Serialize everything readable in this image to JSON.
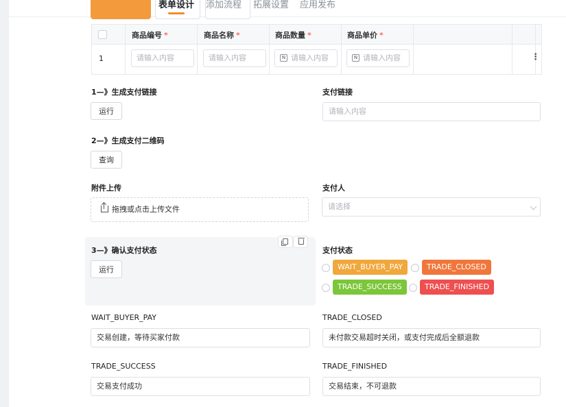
{
  "nav": {
    "tabs": [
      {
        "label": "表单设计",
        "active": true
      },
      {
        "label": "添加流程",
        "active": false
      },
      {
        "label": "拓展设置",
        "active": false
      },
      {
        "label": "应用发布",
        "active": false
      }
    ]
  },
  "table": {
    "columns": [
      {
        "label": "商品编号",
        "required": "*"
      },
      {
        "label": "商品名称",
        "required": "*"
      },
      {
        "label": "商品数量",
        "required": "*"
      },
      {
        "label": "商品单价",
        "required": "*"
      }
    ],
    "row": {
      "index": "1",
      "cells": [
        {
          "placeholder": "请输入内容",
          "icon": ""
        },
        {
          "placeholder": "请输入内容",
          "icon": ""
        },
        {
          "placeholder": "请输入内容",
          "icon": "N"
        },
        {
          "placeholder": "请输入内容",
          "icon": "N"
        }
      ],
      "menu_icon": "⋮"
    }
  },
  "form": {
    "step1": {
      "label": "1—》生成支付链接",
      "button": "运行"
    },
    "pay_link": {
      "label": "支付链接",
      "placeholder": "请输入内容"
    },
    "step2": {
      "label": "2—》生成支付二维码",
      "button": "查询"
    },
    "attachment": {
      "label": "附件上传",
      "upload_text": "拖拽或点击上传文件"
    },
    "payer": {
      "label": "支付人",
      "placeholder": "请选择"
    },
    "step3": {
      "label": "3—》确认支付状态",
      "button": "运行"
    },
    "pay_status": {
      "label": "支付状态",
      "options": [
        {
          "label": "WAIT_BUYER_PAY",
          "color": "#f0a73b"
        },
        {
          "label": "TRADE_CLOSED",
          "color": "#f0773c"
        },
        {
          "label": "TRADE_SUCCESS",
          "color": "#7cc63a"
        },
        {
          "label": "TRADE_FINISHED",
          "color": "#ee4f4f"
        }
      ]
    },
    "wait_buyer_pay": {
      "label": "WAIT_BUYER_PAY",
      "value": "交易创建，等待买家付款"
    },
    "trade_closed": {
      "label": "TRADE_CLOSED",
      "value": "未付款交易超时关闭，或支付完成后全额退款"
    },
    "trade_success": {
      "label": "TRADE_SUCCESS",
      "value": "交易支付成功"
    },
    "trade_finished": {
      "label": "TRADE_FINISHED",
      "value": "交易结束，不可退款"
    }
  }
}
